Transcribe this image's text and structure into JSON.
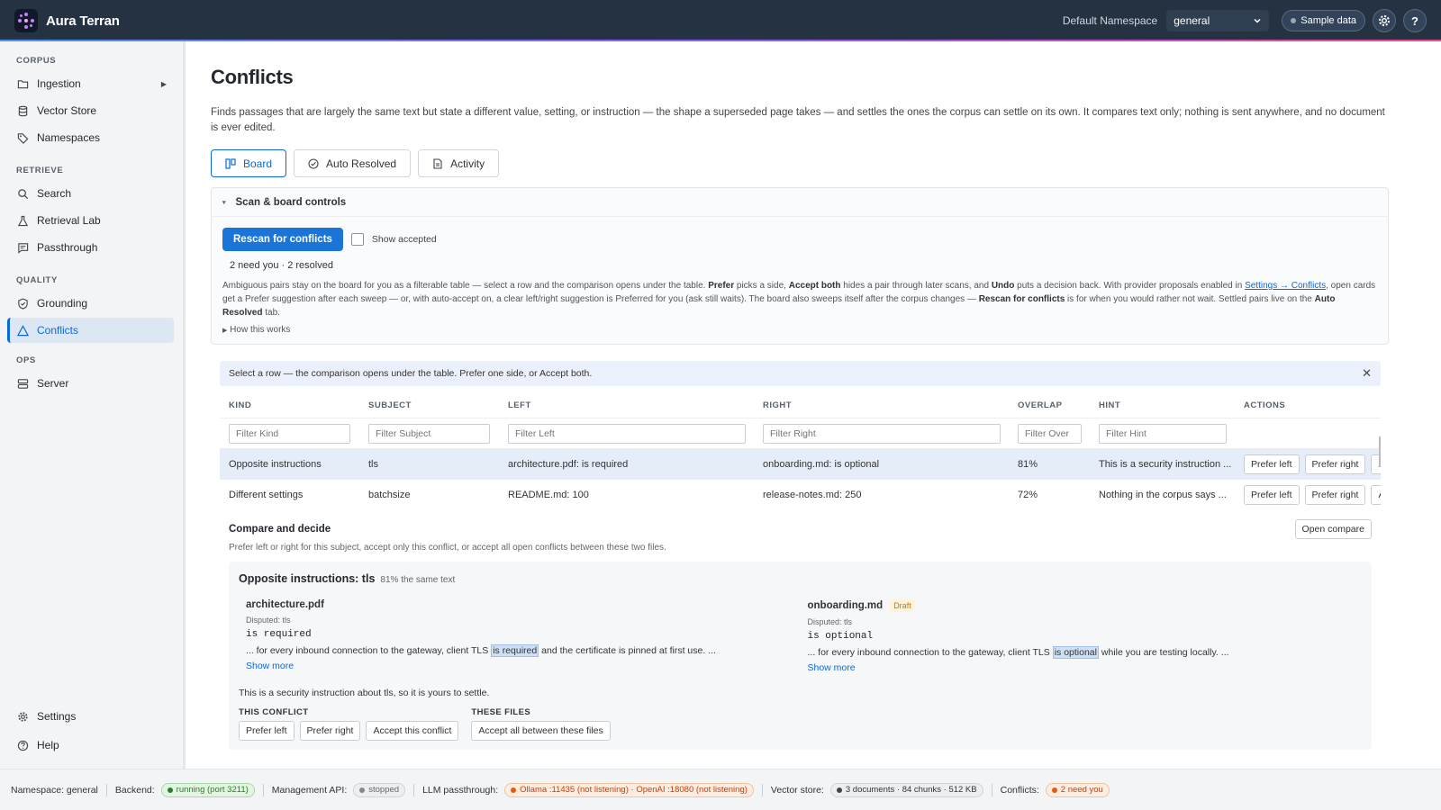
{
  "app": {
    "name": "Aura Terran"
  },
  "topbar": {
    "namespace_label": "Default Namespace",
    "namespace_value": "general",
    "sample_data": "Sample data",
    "settings_icon": "gear-icon",
    "help_icon": "help-icon"
  },
  "sidebar": {
    "sections": {
      "corpus": "CORPUS",
      "retrieve": "RETRIEVE",
      "quality": "QUALITY",
      "ops": "OPS"
    },
    "items": {
      "ingestion": "Ingestion",
      "vector_store": "Vector Store",
      "namespaces": "Namespaces",
      "search": "Search",
      "retrieval_lab": "Retrieval Lab",
      "passthrough": "Passthrough",
      "grounding": "Grounding",
      "conflicts": "Conflicts",
      "server": "Server",
      "settings": "Settings",
      "help": "Help"
    },
    "active": "Conflicts"
  },
  "page": {
    "title": "Conflicts",
    "intro": "Finds passages that are largely the same text but state a different value, setting, or instruction — the shape a superseded page takes — and settles the ones the corpus can settle on its own. It compares text only; nothing is sent anywhere, and no document is ever edited.",
    "tabs": {
      "board": "Board",
      "auto_resolved": "Auto Resolved",
      "activity": "Activity"
    }
  },
  "controls": {
    "header": "Scan & board controls",
    "rescan": "Rescan for conflicts",
    "show_accepted": "Show accepted",
    "counts": "2 need you · 2 resolved",
    "help": {
      "p1": "Ambiguous pairs stay on the board for you as a filterable table — select a row and the comparison opens under the table. ",
      "b1": "Prefer",
      "p2": " picks a side, ",
      "b2": "Accept both",
      "p3": " hides a pair through later scans, and ",
      "b3": "Undo",
      "p4": " puts a decision back. With provider proposals enabled in ",
      "link": "Settings → Conflicts",
      "p5": ", open cards get a Prefer suggestion after each sweep — or, with auto-accept on, a clear left/right suggestion is Preferred for you (ask still waits). The board also sweeps itself after the corpus changes — ",
      "b4": "Rescan for conflicts",
      "p6": " is for when you would rather not wait. Settled pairs live on the ",
      "b5": "Auto Resolved",
      "p7": " tab."
    },
    "how_it_works": "How this works"
  },
  "banner": {
    "text": "Select a row — the comparison opens under the table. Prefer one side, or Accept both."
  },
  "table": {
    "headers": {
      "kind": "KIND",
      "subject": "SUBJECT",
      "left": "LEFT",
      "right": "RIGHT",
      "overlap": "OVERLAP",
      "hint": "HINT",
      "actions": "ACTIONS"
    },
    "filters": {
      "kind": "Filter Kind",
      "subject": "Filter Subject",
      "left": "Filter Left",
      "right": "Filter Right",
      "overlap": "Filter Over",
      "hint": "Filter Hint"
    },
    "rows": [
      {
        "kind": "Opposite instructions",
        "subject": "tls",
        "left": "architecture.pdf: is required",
        "right": "onboarding.md: is optional",
        "overlap": "81%",
        "hint": "This is a security instruction ..."
      },
      {
        "kind": "Different settings",
        "subject": "batchsize",
        "left": "README.md: 100",
        "right": "release-notes.md: 250",
        "overlap": "72%",
        "hint": "Nothing in the corpus says ..."
      }
    ],
    "actions": {
      "prefer_left": "Prefer left",
      "prefer_right": "Prefer right",
      "accept": "Ac"
    }
  },
  "compare": {
    "title": "Compare and decide",
    "open": "Open compare",
    "subtitle": "Prefer left or right for this subject, accept only this conflict, or accept all open conflicts between these two files.",
    "card_title": "Opposite instructions: tls",
    "card_sub": "81% the same text",
    "left": {
      "file": "architecture.pdf",
      "disputed": "Disputed: tls",
      "value": "is required",
      "ctx_pre": "... for every inbound connection to the gateway, client TLS ",
      "ctx_hl": "is required",
      "ctx_post": " and the certificate is pinned at first use. ...",
      "more": "Show more"
    },
    "right": {
      "file": "onboarding.md",
      "badge": "Draft",
      "disputed": "Disputed: tls",
      "value": "is optional",
      "ctx_pre": "... for every inbound connection to the gateway, client TLS ",
      "ctx_hl": "is optional",
      "ctx_post": " while you are testing locally. ...",
      "more": "Show more"
    },
    "note": "This is a security instruction about tls, so it is yours to settle.",
    "this_conflict": "THIS CONFLICT",
    "these_files": "THESE FILES",
    "buttons": {
      "prefer_left": "Prefer left",
      "prefer_right": "Prefer right",
      "accept_this": "Accept this conflict",
      "accept_all": "Accept all between these files"
    }
  },
  "status": {
    "namespace": "Namespace: general",
    "backend_label": "Backend:",
    "backend": "running (port 3211)",
    "mgmt_label": "Management API:",
    "mgmt": "stopped",
    "llm_label": "LLM passthrough:",
    "llm": "Ollama :11435 (not listening) · OpenAI :18080 (not listening)",
    "vector_label": "Vector store:",
    "vector": "3 documents · 84 chunks · 512 KB",
    "conflicts_label": "Conflicts:",
    "conflicts": "2 need you"
  }
}
